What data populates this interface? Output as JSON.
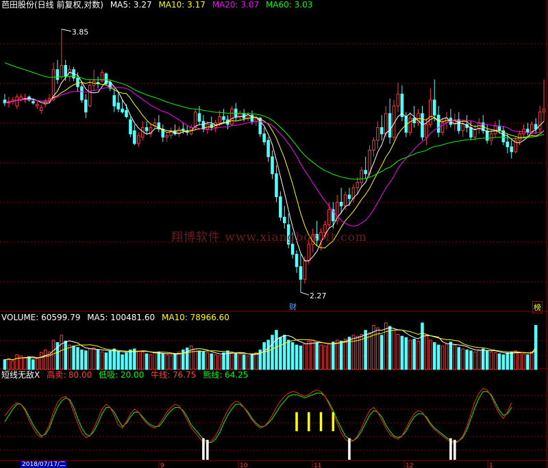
{
  "main": {
    "title": "芭田股份(日线 前复权,对数)",
    "ma5_label": "MA5: 3.27",
    "ma10_label": "MA10: 3.17",
    "ma20_label": "MA20: 3.07",
    "ma60_label": "MA60: 3.03",
    "high_marker": "3.85",
    "low_marker": "2.27",
    "tag_cai": "财",
    "tag_bang": "榜",
    "watermark": "翔博软件 www.xiangbosoft.com"
  },
  "volume": {
    "label": "VOLUME: 60599.79",
    "ma5_label": "MA5: 100481.60",
    "ma10_label": "MA10: 78966.60"
  },
  "indicator": {
    "name": "短线无敌X",
    "sell_label": "高卖: 80.00",
    "buy_label": "低吸: 20.00",
    "bull_label": "牛线: 76.75",
    "bear_label": "熊线: 64.25"
  },
  "axis": {
    "date_label": "2018/07/17/二",
    "month_labels": [
      "9",
      "10",
      "11",
      "12",
      "1"
    ]
  },
  "colors": {
    "up": "#ff3b3b",
    "down": "#54ffff",
    "ma5": "#ffffff",
    "ma10": "#ffff00",
    "ma20": "#ff00ff",
    "ma60": "#00ff00",
    "grid": "#8b0000"
  },
  "chart_data": {
    "type": "candlestick",
    "symbol": "芭田股份",
    "price_range": [
      2.27,
      3.85
    ],
    "last": {
      "ma5": 3.27,
      "ma10": 3.17,
      "ma20": 3.07,
      "ma60": 3.03,
      "volume": 60599.79,
      "vol_ma5": 100481.6,
      "vol_ma10": 78966.6,
      "bull": 76.75,
      "bear": 64.25
    },
    "indicator_thresholds": {
      "sell": 80.0,
      "buy": 20.0
    },
    "candles": [
      [
        3.34,
        3.38,
        3.3,
        3.32
      ],
      [
        3.32,
        3.36,
        3.29,
        3.33
      ],
      [
        3.33,
        3.36,
        3.31,
        3.34
      ],
      [
        3.3,
        3.38,
        3.28,
        3.36
      ],
      [
        3.34,
        3.38,
        3.33,
        3.36
      ],
      [
        3.35,
        3.38,
        3.32,
        3.35
      ],
      [
        3.36,
        3.37,
        3.33,
        3.34
      ],
      [
        3.33,
        3.35,
        3.31,
        3.32
      ],
      [
        3.3,
        3.33,
        3.28,
        3.31
      ],
      [
        3.27,
        3.31,
        3.25,
        3.29
      ],
      [
        3.31,
        3.35,
        3.29,
        3.33
      ],
      [
        3.33,
        3.38,
        3.32,
        3.35
      ],
      [
        3.34,
        3.6,
        3.33,
        3.55
      ],
      [
        3.55,
        3.62,
        3.45,
        3.48
      ],
      [
        3.5,
        3.85,
        3.48,
        3.58
      ],
      [
        3.58,
        3.62,
        3.47,
        3.5
      ],
      [
        3.5,
        3.58,
        3.47,
        3.55
      ],
      [
        3.55,
        3.57,
        3.47,
        3.49
      ],
      [
        3.49,
        3.53,
        3.4,
        3.43
      ],
      [
        3.43,
        3.47,
        3.32,
        3.34
      ],
      [
        3.34,
        3.38,
        3.22,
        3.26
      ],
      [
        3.3,
        3.48,
        3.29,
        3.44
      ],
      [
        3.44,
        3.55,
        3.4,
        3.47
      ],
      [
        3.46,
        3.5,
        3.42,
        3.45
      ],
      [
        3.47,
        3.55,
        3.46,
        3.53
      ],
      [
        3.52,
        3.53,
        3.44,
        3.45
      ],
      [
        3.46,
        3.48,
        3.4,
        3.42
      ],
      [
        3.37,
        3.42,
        3.26,
        3.3
      ],
      [
        3.32,
        3.39,
        3.26,
        3.28
      ],
      [
        3.28,
        3.34,
        3.25,
        3.26
      ],
      [
        3.27,
        3.31,
        3.22,
        3.23
      ],
      [
        3.21,
        3.23,
        3.1,
        3.12
      ],
      [
        3.14,
        3.18,
        3.05,
        3.06
      ],
      [
        3.06,
        3.13,
        3.04,
        3.11
      ],
      [
        3.1,
        3.2,
        3.08,
        3.16
      ],
      [
        3.16,
        3.2,
        3.12,
        3.14
      ],
      [
        3.12,
        3.18,
        3.1,
        3.16
      ],
      [
        3.17,
        3.22,
        3.15,
        3.19
      ],
      [
        3.19,
        3.24,
        3.13,
        3.15
      ],
      [
        3.15,
        3.18,
        3.07,
        3.1
      ],
      [
        3.1,
        3.13,
        3.07,
        3.11
      ],
      [
        3.11,
        3.16,
        3.09,
        3.14
      ],
      [
        3.14,
        3.18,
        3.11,
        3.12
      ],
      [
        3.12,
        3.17,
        3.1,
        3.15
      ],
      [
        3.15,
        3.19,
        3.12,
        3.14
      ],
      [
        3.14,
        3.17,
        3.11,
        3.13
      ],
      [
        3.12,
        3.18,
        3.11,
        3.16
      ],
      [
        3.16,
        3.28,
        3.14,
        3.26
      ],
      [
        3.25,
        3.3,
        3.18,
        3.2
      ],
      [
        3.2,
        3.24,
        3.13,
        3.15
      ],
      [
        3.15,
        3.2,
        3.12,
        3.18
      ],
      [
        3.18,
        3.23,
        3.14,
        3.16
      ],
      [
        3.16,
        3.21,
        3.13,
        3.19
      ],
      [
        3.19,
        3.27,
        3.17,
        3.23
      ],
      [
        3.23,
        3.28,
        3.19,
        3.21
      ],
      [
        3.21,
        3.24,
        3.15,
        3.18
      ],
      [
        3.18,
        3.3,
        3.17,
        3.28
      ],
      [
        3.28,
        3.32,
        3.2,
        3.23
      ],
      [
        3.23,
        3.27,
        3.21,
        3.25
      ],
      [
        3.25,
        3.28,
        3.2,
        3.22
      ],
      [
        3.22,
        3.26,
        3.2,
        3.24
      ],
      [
        3.24,
        3.27,
        3.18,
        3.2
      ],
      [
        3.2,
        3.24,
        3.17,
        3.22
      ],
      [
        3.22,
        3.23,
        3.1,
        3.12
      ],
      [
        3.12,
        3.16,
        3.05,
        3.07
      ],
      [
        3.08,
        3.1,
        2.95,
        2.98
      ],
      [
        2.98,
        3.02,
        2.85,
        2.88
      ],
      [
        2.88,
        2.93,
        2.72,
        2.75
      ],
      [
        2.75,
        2.78,
        2.62,
        2.64
      ],
      [
        2.64,
        2.7,
        2.58,
        2.61
      ],
      [
        2.6,
        2.66,
        2.48,
        2.5
      ],
      [
        2.5,
        2.56,
        2.43,
        2.45
      ],
      [
        2.45,
        2.47,
        2.36,
        2.39
      ],
      [
        2.39,
        2.45,
        2.27,
        2.33
      ],
      [
        2.33,
        2.44,
        2.31,
        2.42
      ],
      [
        2.42,
        2.53,
        2.4,
        2.5
      ],
      [
        2.5,
        2.58,
        2.46,
        2.55
      ],
      [
        2.55,
        2.62,
        2.49,
        2.52
      ],
      [
        2.52,
        2.58,
        2.47,
        2.56
      ],
      [
        2.56,
        2.62,
        2.53,
        2.6
      ],
      [
        2.6,
        2.72,
        2.58,
        2.68
      ],
      [
        2.68,
        2.72,
        2.58,
        2.62
      ],
      [
        2.62,
        2.76,
        2.6,
        2.72
      ],
      [
        2.72,
        2.8,
        2.66,
        2.7
      ],
      [
        2.7,
        2.78,
        2.68,
        2.76
      ],
      [
        2.76,
        2.8,
        2.7,
        2.74
      ],
      [
        2.74,
        2.82,
        2.72,
        2.8
      ],
      [
        2.8,
        2.86,
        2.76,
        2.83
      ],
      [
        2.83,
        2.92,
        2.8,
        2.9
      ],
      [
        2.9,
        2.98,
        2.85,
        2.88
      ],
      [
        2.88,
        3.05,
        2.86,
        3.02
      ],
      [
        3.02,
        3.1,
        2.98,
        3.08
      ],
      [
        3.08,
        3.2,
        3.03,
        3.16
      ],
      [
        3.16,
        3.24,
        3.08,
        3.12
      ],
      [
        3.12,
        3.3,
        3.1,
        3.25
      ],
      [
        3.25,
        3.35,
        3.06,
        3.1
      ],
      [
        3.1,
        3.34,
        3.08,
        3.3
      ],
      [
        3.3,
        3.46,
        3.26,
        3.38
      ],
      [
        3.38,
        3.44,
        3.2,
        3.23
      ],
      [
        3.23,
        3.26,
        3.1,
        3.13
      ],
      [
        3.13,
        3.26,
        3.11,
        3.22
      ],
      [
        3.22,
        3.3,
        3.16,
        3.19
      ],
      [
        3.19,
        3.28,
        3.17,
        3.25
      ],
      [
        3.25,
        3.3,
        3.08,
        3.1
      ],
      [
        3.1,
        3.22,
        3.05,
        3.18
      ],
      [
        3.18,
        3.42,
        3.16,
        3.34
      ],
      [
        3.34,
        3.48,
        3.2,
        3.24
      ],
      [
        3.24,
        3.3,
        3.1,
        3.13
      ],
      [
        3.13,
        3.22,
        3.11,
        3.19
      ],
      [
        3.19,
        3.26,
        3.15,
        3.22
      ],
      [
        3.22,
        3.28,
        3.16,
        3.18
      ],
      [
        3.18,
        3.25,
        3.14,
        3.21
      ],
      [
        3.21,
        3.26,
        3.12,
        3.14
      ],
      [
        3.14,
        3.2,
        3.1,
        3.18
      ],
      [
        3.18,
        3.24,
        3.13,
        3.16
      ],
      [
        3.16,
        3.2,
        3.08,
        3.1
      ],
      [
        3.1,
        3.18,
        3.08,
        3.15
      ],
      [
        3.15,
        3.22,
        3.12,
        3.19
      ],
      [
        3.19,
        3.24,
        3.12,
        3.14
      ],
      [
        3.14,
        3.18,
        3.06,
        3.08
      ],
      [
        3.08,
        3.15,
        3.05,
        3.12
      ],
      [
        3.12,
        3.2,
        3.1,
        3.17
      ],
      [
        3.17,
        3.21,
        3.12,
        3.14
      ],
      [
        3.14,
        3.17,
        3.05,
        3.07
      ],
      [
        3.07,
        3.12,
        3.0,
        3.04
      ],
      [
        3.04,
        3.08,
        2.97,
        3.01
      ],
      [
        3.01,
        3.1,
        3.0,
        3.08
      ],
      [
        3.08,
        3.14,
        3.05,
        3.12
      ],
      [
        3.12,
        3.18,
        3.09,
        3.15
      ],
      [
        3.15,
        3.19,
        3.11,
        3.13
      ],
      [
        3.13,
        3.2,
        3.11,
        3.18
      ],
      [
        3.18,
        3.22,
        3.12,
        3.15
      ],
      [
        3.15,
        3.3,
        3.13,
        3.26
      ],
      [
        3.26,
        3.48,
        3.2,
        3.28
      ]
    ],
    "volume_series": [
      20,
      22,
      18,
      30,
      28,
      24,
      26,
      20,
      22,
      35,
      40,
      36,
      60,
      55,
      70,
      58,
      50,
      48,
      45,
      40,
      38,
      42,
      44,
      40,
      36,
      34,
      38,
      42,
      36,
      30,
      34,
      40,
      42,
      38,
      36,
      32,
      30,
      34,
      36,
      32,
      30,
      28,
      32,
      36,
      40,
      44,
      48,
      42,
      38,
      36,
      34,
      32,
      30,
      28,
      34,
      38,
      36,
      34,
      32,
      30,
      28,
      30,
      34,
      40,
      55,
      60,
      70,
      80,
      65,
      70,
      60,
      55,
      50,
      48,
      52,
      58,
      60,
      55,
      50,
      48,
      52,
      56,
      60,
      58,
      62,
      66,
      70,
      68,
      72,
      80,
      75,
      90,
      85,
      70,
      95,
      88,
      80,
      72,
      68,
      65,
      60,
      62,
      58,
      95,
      70,
      60,
      55,
      50,
      48,
      52,
      56,
      50,
      45,
      42,
      40,
      38,
      36,
      40,
      42,
      38,
      36,
      34,
      32,
      30,
      34,
      36,
      38,
      34,
      32,
      30,
      36,
      90
    ],
    "bull_line": [
      55,
      62,
      68,
      72,
      70,
      62,
      50,
      40,
      32,
      28,
      34,
      44,
      60,
      72,
      78,
      80,
      74,
      60,
      46,
      34,
      28,
      30,
      40,
      52,
      64,
      70,
      66,
      56,
      44,
      40,
      48,
      58,
      64,
      60,
      52,
      46,
      42,
      40,
      44,
      52,
      60,
      66,
      70,
      68,
      60,
      50,
      40,
      34,
      28,
      22,
      20,
      24,
      30,
      40,
      52,
      62,
      70,
      74,
      72,
      66,
      58,
      50,
      44,
      40,
      42,
      48,
      56,
      66,
      74,
      80,
      84,
      86,
      85,
      82,
      80,
      82,
      86,
      88,
      86,
      80,
      70,
      58,
      46,
      34,
      26,
      22,
      24,
      30,
      40,
      52,
      62,
      66,
      60,
      50,
      40,
      32,
      28,
      26,
      30,
      40,
      50,
      58,
      62,
      60,
      52,
      44,
      38,
      34,
      30,
      26,
      22,
      20,
      24,
      30,
      42,
      58,
      74,
      84,
      90,
      88,
      80,
      68,
      58,
      52,
      60,
      72
    ],
    "bear_line": [
      48,
      56,
      64,
      70,
      70,
      64,
      54,
      44,
      36,
      30,
      32,
      40,
      54,
      66,
      74,
      78,
      76,
      66,
      52,
      40,
      32,
      30,
      36,
      46,
      58,
      66,
      66,
      60,
      50,
      42,
      46,
      54,
      60,
      60,
      54,
      48,
      44,
      42,
      42,
      48,
      56,
      62,
      66,
      66,
      62,
      54,
      44,
      38,
      32,
      26,
      22,
      22,
      26,
      34,
      46,
      56,
      64,
      70,
      70,
      66,
      60,
      52,
      46,
      42,
      42,
      46,
      52,
      60,
      68,
      74,
      80,
      82,
      82,
      80,
      78,
      80,
      82,
      84,
      84,
      80,
      72,
      62,
      50,
      40,
      30,
      26,
      24,
      28,
      36,
      46,
      56,
      62,
      60,
      54,
      44,
      36,
      30,
      28,
      30,
      36,
      46,
      54,
      58,
      58,
      54,
      46,
      40,
      36,
      32,
      28,
      24,
      22,
      24,
      28,
      38,
      52,
      66,
      78,
      86,
      86,
      82,
      72,
      62,
      56,
      58,
      66
    ]
  }
}
